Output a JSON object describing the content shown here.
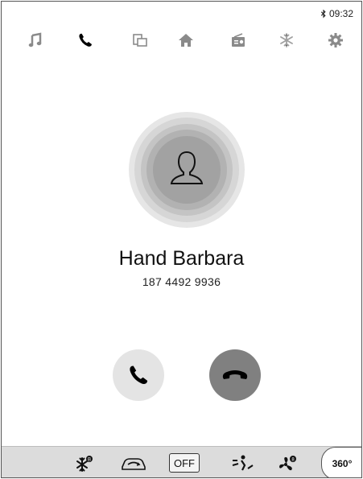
{
  "status_bar": {
    "time": "09:32",
    "bluetooth_icon": "bluetooth-icon"
  },
  "nav": [
    {
      "id": "music",
      "icon": "music-note-icon"
    },
    {
      "id": "phone",
      "icon": "phone-icon",
      "active": true
    },
    {
      "id": "screen-mirror",
      "icon": "screen-mirror-icon"
    },
    {
      "id": "home",
      "icon": "home-icon"
    },
    {
      "id": "radio",
      "icon": "radio-icon"
    },
    {
      "id": "climate",
      "icon": "snowflake-icon"
    },
    {
      "id": "settings",
      "icon": "gear-icon"
    }
  ],
  "call": {
    "name": "Hand Barbara",
    "number": "187 4492 9936",
    "answer_icon": "phone-icon",
    "hangup_icon": "hang-up-icon"
  },
  "bottom_bar": {
    "off_label": "OFF",
    "camera_label": "360°",
    "items": [
      "defrost-icon",
      "recirculation-icon",
      "off-button",
      "airflow-icon",
      "fan-icon",
      "360-camera-icon"
    ]
  },
  "colors": {
    "active_icon": "#000000",
    "inactive_icon": "#8a8a8a",
    "hangup_bg": "#808080",
    "answer_bg": "#e4e4e4",
    "bar_bg": "#dcdcdc"
  }
}
